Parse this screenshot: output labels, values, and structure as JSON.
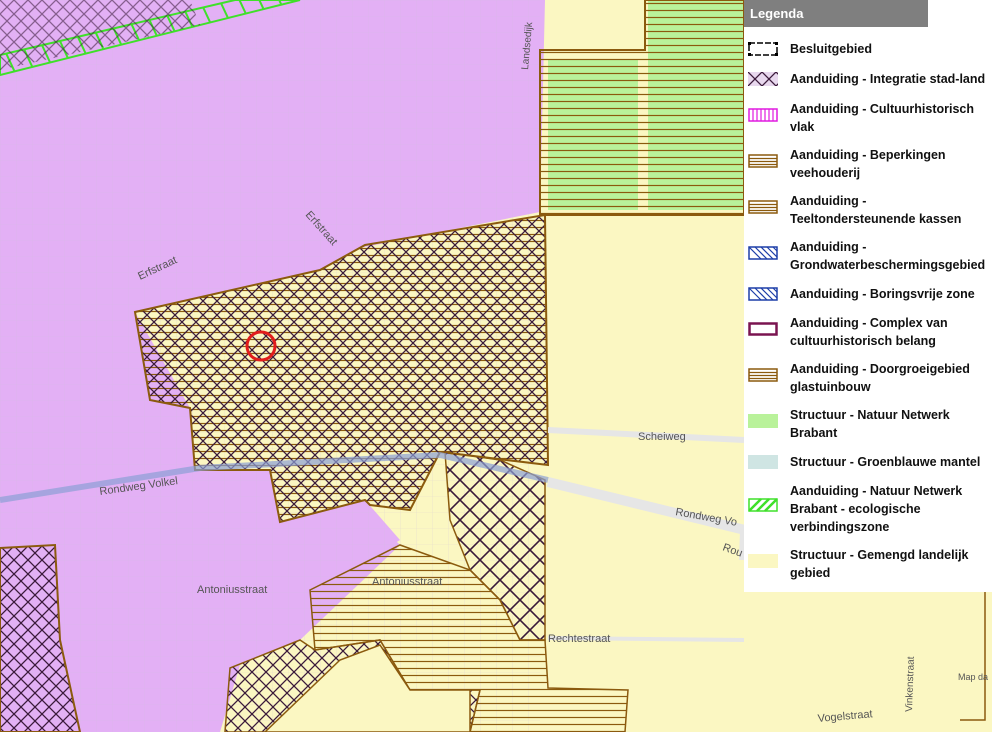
{
  "colors": {
    "pink": "#e3b0f5",
    "yellow": "#fbf7c2",
    "brown": "#8b5a0e",
    "green": "#3fe02a",
    "light_green": "#b9f29a",
    "dark_purple": "#3a1a3a",
    "red_marker": "#e11c1c"
  },
  "legend": {
    "title": "Legenda",
    "items": [
      {
        "label": "Besluitgebied",
        "swatch": "boundary"
      },
      {
        "label": "Aanduiding - Integratie stad-land",
        "swatch": "crosshatch-dark"
      },
      {
        "label": "Aanduiding - Cultuurhistorisch vlak",
        "swatch": "vertical-magenta"
      },
      {
        "label": "Aanduiding - Beperkingen veehouderij",
        "swatch": "horizontal-brown"
      },
      {
        "label": "Aanduiding - Teeltondersteunende kassen",
        "swatch": "horizontal-brown"
      },
      {
        "label": "Aanduiding - Grondwaterbeschermingsgebied",
        "swatch": "diagonal-blue"
      },
      {
        "label": "Aanduiding - Boringsvrije zone",
        "swatch": "diagonal-blue"
      },
      {
        "label": "Aanduiding - Complex van cultuurhistorisch belang",
        "swatch": "outline-purple"
      },
      {
        "label": "Aanduiding - Doorgroeigebied glastuinbouw",
        "swatch": "horizontal-brown"
      },
      {
        "label": "Structuur - Natuur Netwerk Brabant",
        "swatch": "fill-lightgreen"
      },
      {
        "label": "Structuur - Groenblauwe mantel",
        "swatch": "fill-lightblue"
      },
      {
        "label": "Aanduiding - Natuur Netwerk Brabant - ecologische verbindingszone",
        "swatch": "diagonal-green"
      },
      {
        "label": "Structuur - Gemengd landelijk gebied",
        "swatch": "fill-yellow"
      }
    ]
  },
  "street_labels": {
    "erfstraat_1": "Erfstraat",
    "erfstraat_2": "Erfstraat",
    "scheiweg": "Scheiweg",
    "rondweg_volkel_left": "Rondweg Volkel",
    "rondweg_volkel_right": "Rondweg Vo",
    "rou": "Rou",
    "antoniusstraat_1": "Antoniusstraat",
    "antoniusstraat_2": "Antoniusstraat",
    "rechtestraat": "Rechtestraat",
    "vinkenstraat": "Vinkenstraat",
    "vogelstraat": "Vogelstraat",
    "landsedijk": "Landsedijk",
    "map_credit": "Map da"
  }
}
